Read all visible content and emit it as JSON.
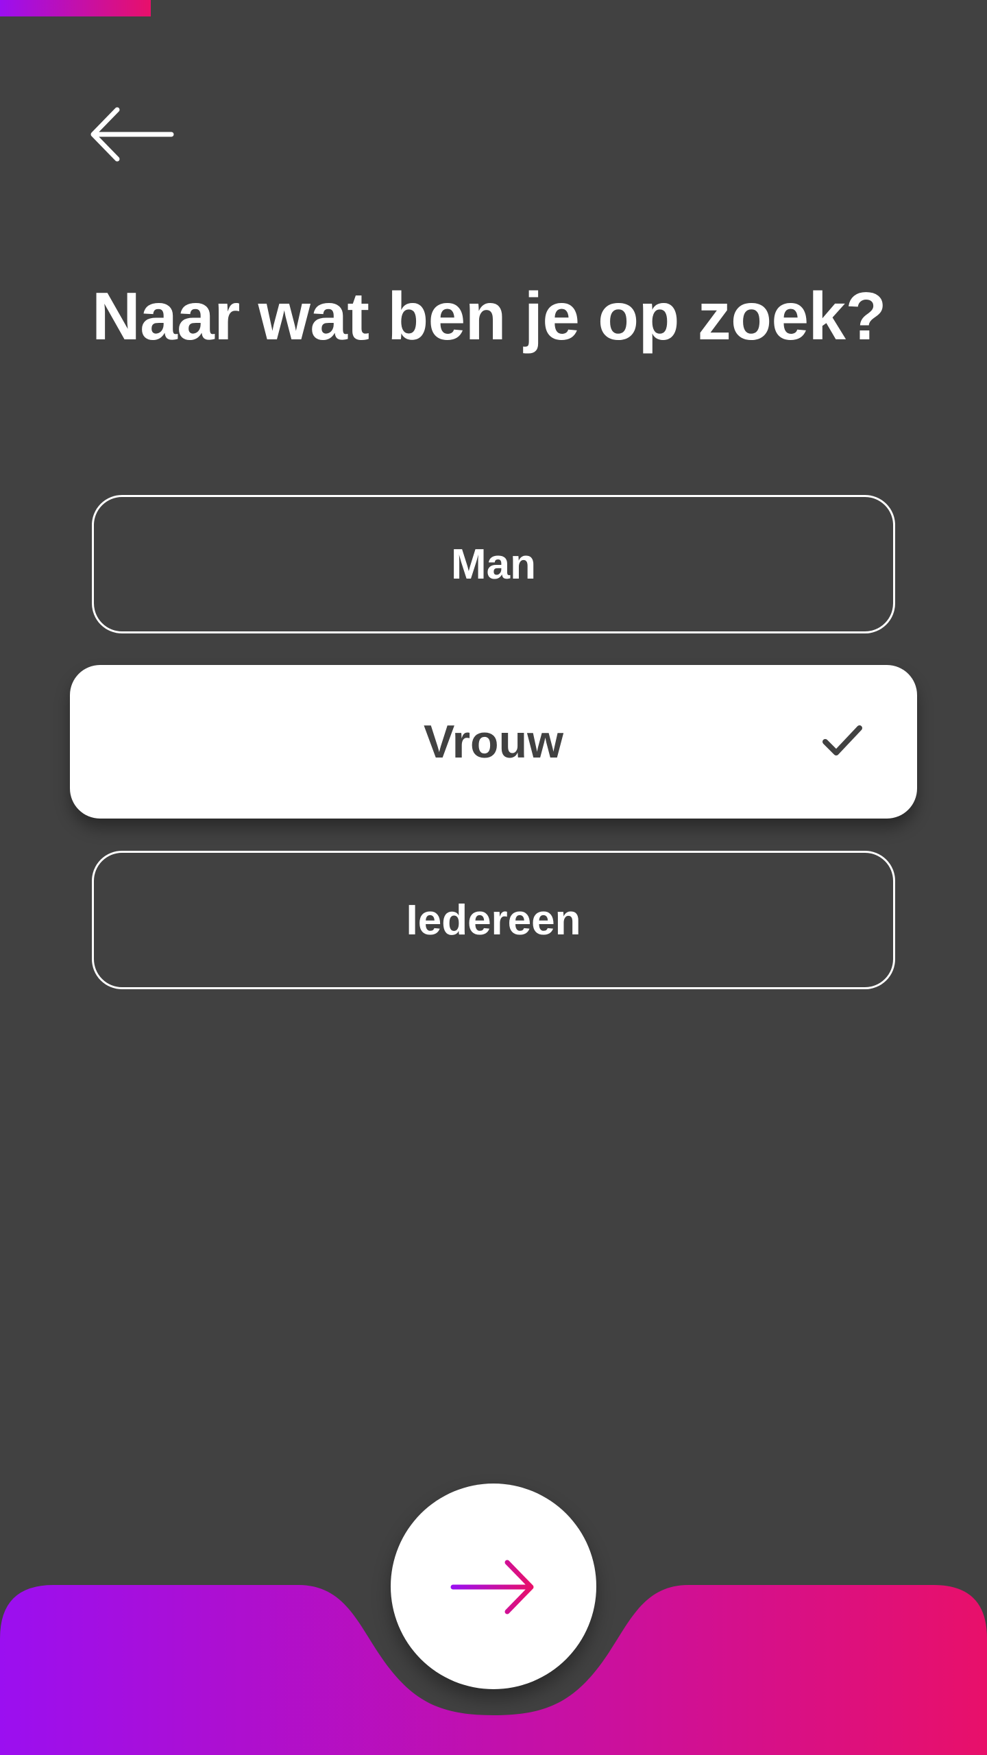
{
  "progress": {
    "fraction": 0.153,
    "gradient_start": "#9b0ff0",
    "gradient_end": "#e8106a"
  },
  "header": {
    "back_icon": "arrow-left-icon"
  },
  "page": {
    "title": "Naar wat ben je op zoek?"
  },
  "options": [
    {
      "label": "Man",
      "selected": false
    },
    {
      "label": "Vrouw",
      "selected": true,
      "check_icon": "checkmark-icon"
    },
    {
      "label": "Iedereen",
      "selected": false
    }
  ],
  "footer": {
    "next_icon": "arrow-right-icon",
    "background_gradient": [
      "#9b0ff0",
      "#e8106a"
    ]
  },
  "colors": {
    "background": "#414141",
    "accent_start": "#9b0ff0",
    "accent_end": "#e8106a"
  }
}
